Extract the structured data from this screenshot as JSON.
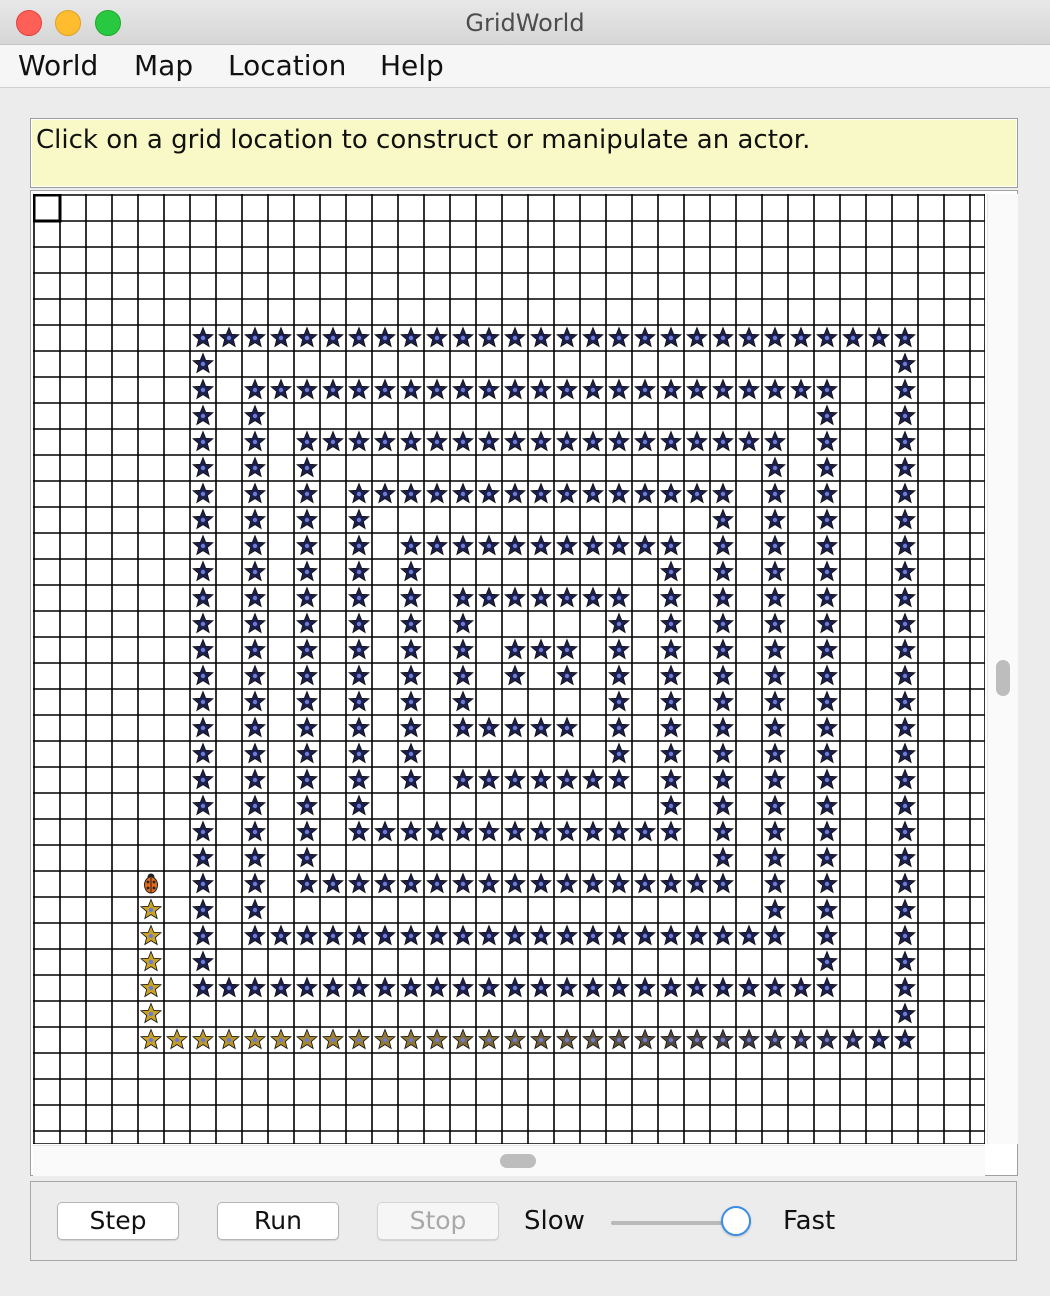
{
  "window": {
    "title": "GridWorld"
  },
  "menubar": {
    "items": [
      "World",
      "Map",
      "Location",
      "Help"
    ]
  },
  "message": "Click on a grid location to construct or manipulate an actor.",
  "grid": {
    "visible_rows": 37,
    "visible_cols": 37,
    "selected_cell": [
      0,
      0
    ],
    "bug": {
      "row": 26,
      "col": 4,
      "icon": "ladybug-icon"
    },
    "colors": {
      "line": "#000000",
      "cell": "#ffffff",
      "blue_flower": "#1c1f4e",
      "yellow_flower": "#c9a227",
      "flower_center": "#6a7cd6",
      "bug_body": "#e36a1a"
    },
    "blue_flowers": {
      "rows": [
        {
          "row": 5,
          "cols": [
            [
              6,
              33
            ]
          ]
        },
        {
          "row": 6,
          "cols": [
            6,
            33
          ]
        },
        {
          "row": 7,
          "cols": [
            6,
            [
              8,
              30
            ],
            33
          ]
        },
        {
          "row": 8,
          "cols": [
            6,
            8,
            30,
            33
          ]
        },
        {
          "row": 9,
          "cols": [
            6,
            8,
            [
              10,
              28
            ],
            30,
            33
          ]
        },
        {
          "row": 10,
          "cols": [
            6,
            8,
            10,
            28,
            30,
            33
          ]
        },
        {
          "row": 11,
          "cols": [
            6,
            8,
            10,
            [
              12,
              26
            ],
            28,
            30,
            33
          ]
        },
        {
          "row": 12,
          "cols": [
            6,
            8,
            10,
            12,
            26,
            28,
            30,
            33
          ]
        },
        {
          "row": 13,
          "cols": [
            6,
            8,
            10,
            12,
            [
              14,
              24
            ],
            26,
            28,
            30,
            33
          ]
        },
        {
          "row": 14,
          "cols": [
            6,
            8,
            10,
            12,
            14,
            24,
            26,
            28,
            30,
            33
          ]
        },
        {
          "row": 15,
          "cols": [
            6,
            8,
            10,
            12,
            14,
            [
              16,
              22
            ],
            24,
            26,
            28,
            30,
            33
          ]
        },
        {
          "row": 16,
          "cols": [
            6,
            8,
            10,
            12,
            14,
            16,
            22,
            24,
            26,
            28,
            30,
            33
          ]
        },
        {
          "row": 17,
          "cols": [
            6,
            8,
            10,
            12,
            14,
            16,
            [
              18,
              20
            ],
            22,
            24,
            26,
            28,
            30,
            33
          ]
        },
        {
          "row": 18,
          "cols": [
            6,
            8,
            10,
            12,
            14,
            16,
            18,
            20,
            22,
            24,
            26,
            28,
            30,
            33
          ]
        },
        {
          "row": 19,
          "cols": [
            6,
            8,
            10,
            12,
            14,
            16,
            22,
            24,
            26,
            28,
            30,
            33
          ]
        },
        {
          "row": 20,
          "cols": [
            6,
            8,
            10,
            12,
            14,
            [
              16,
              20
            ],
            22,
            24,
            26,
            28,
            30,
            33
          ]
        },
        {
          "row": 21,
          "cols": [
            6,
            8,
            10,
            12,
            14,
            22,
            24,
            26,
            28,
            30,
            33
          ]
        },
        {
          "row": 22,
          "cols": [
            6,
            8,
            10,
            12,
            14,
            [
              16,
              22
            ],
            24,
            26,
            28,
            30,
            33
          ]
        },
        {
          "row": 23,
          "cols": [
            6,
            8,
            10,
            12,
            24,
            26,
            28,
            30,
            33
          ]
        },
        {
          "row": 24,
          "cols": [
            6,
            8,
            10,
            [
              12,
              24
            ],
            26,
            28,
            30,
            33
          ]
        },
        {
          "row": 25,
          "cols": [
            6,
            8,
            10,
            26,
            28,
            30,
            33
          ]
        },
        {
          "row": 26,
          "cols": [
            6,
            8,
            [
              10,
              26
            ],
            28,
            30,
            33
          ]
        },
        {
          "row": 27,
          "cols": [
            6,
            8,
            28,
            30,
            33
          ]
        },
        {
          "row": 28,
          "cols": [
            6,
            [
              8,
              28
            ],
            30,
            33
          ]
        },
        {
          "row": 29,
          "cols": [
            6,
            30,
            33
          ]
        },
        {
          "row": 30,
          "cols": [
            [
              6,
              30
            ],
            33
          ]
        },
        {
          "row": 31,
          "cols": [
            33
          ]
        }
      ]
    },
    "yellow_flowers": {
      "rows": [
        {
          "row": 27,
          "cols": [
            4
          ]
        },
        {
          "row": 28,
          "cols": [
            4
          ]
        },
        {
          "row": 29,
          "cols": [
            4
          ]
        },
        {
          "row": 30,
          "cols": [
            4
          ]
        },
        {
          "row": 31,
          "cols": [
            4
          ]
        },
        {
          "row": 32,
          "cols": [
            [
              4,
              33
            ]
          ]
        }
      ]
    },
    "flower_fade": {
      "row": 32,
      "from_col": 4,
      "to_col": 33
    }
  },
  "controls": {
    "step_label": "Step",
    "run_label": "Run",
    "stop_label": "Stop",
    "slow_label": "Slow",
    "fast_label": "Fast",
    "speed_fraction": 0.89
  }
}
